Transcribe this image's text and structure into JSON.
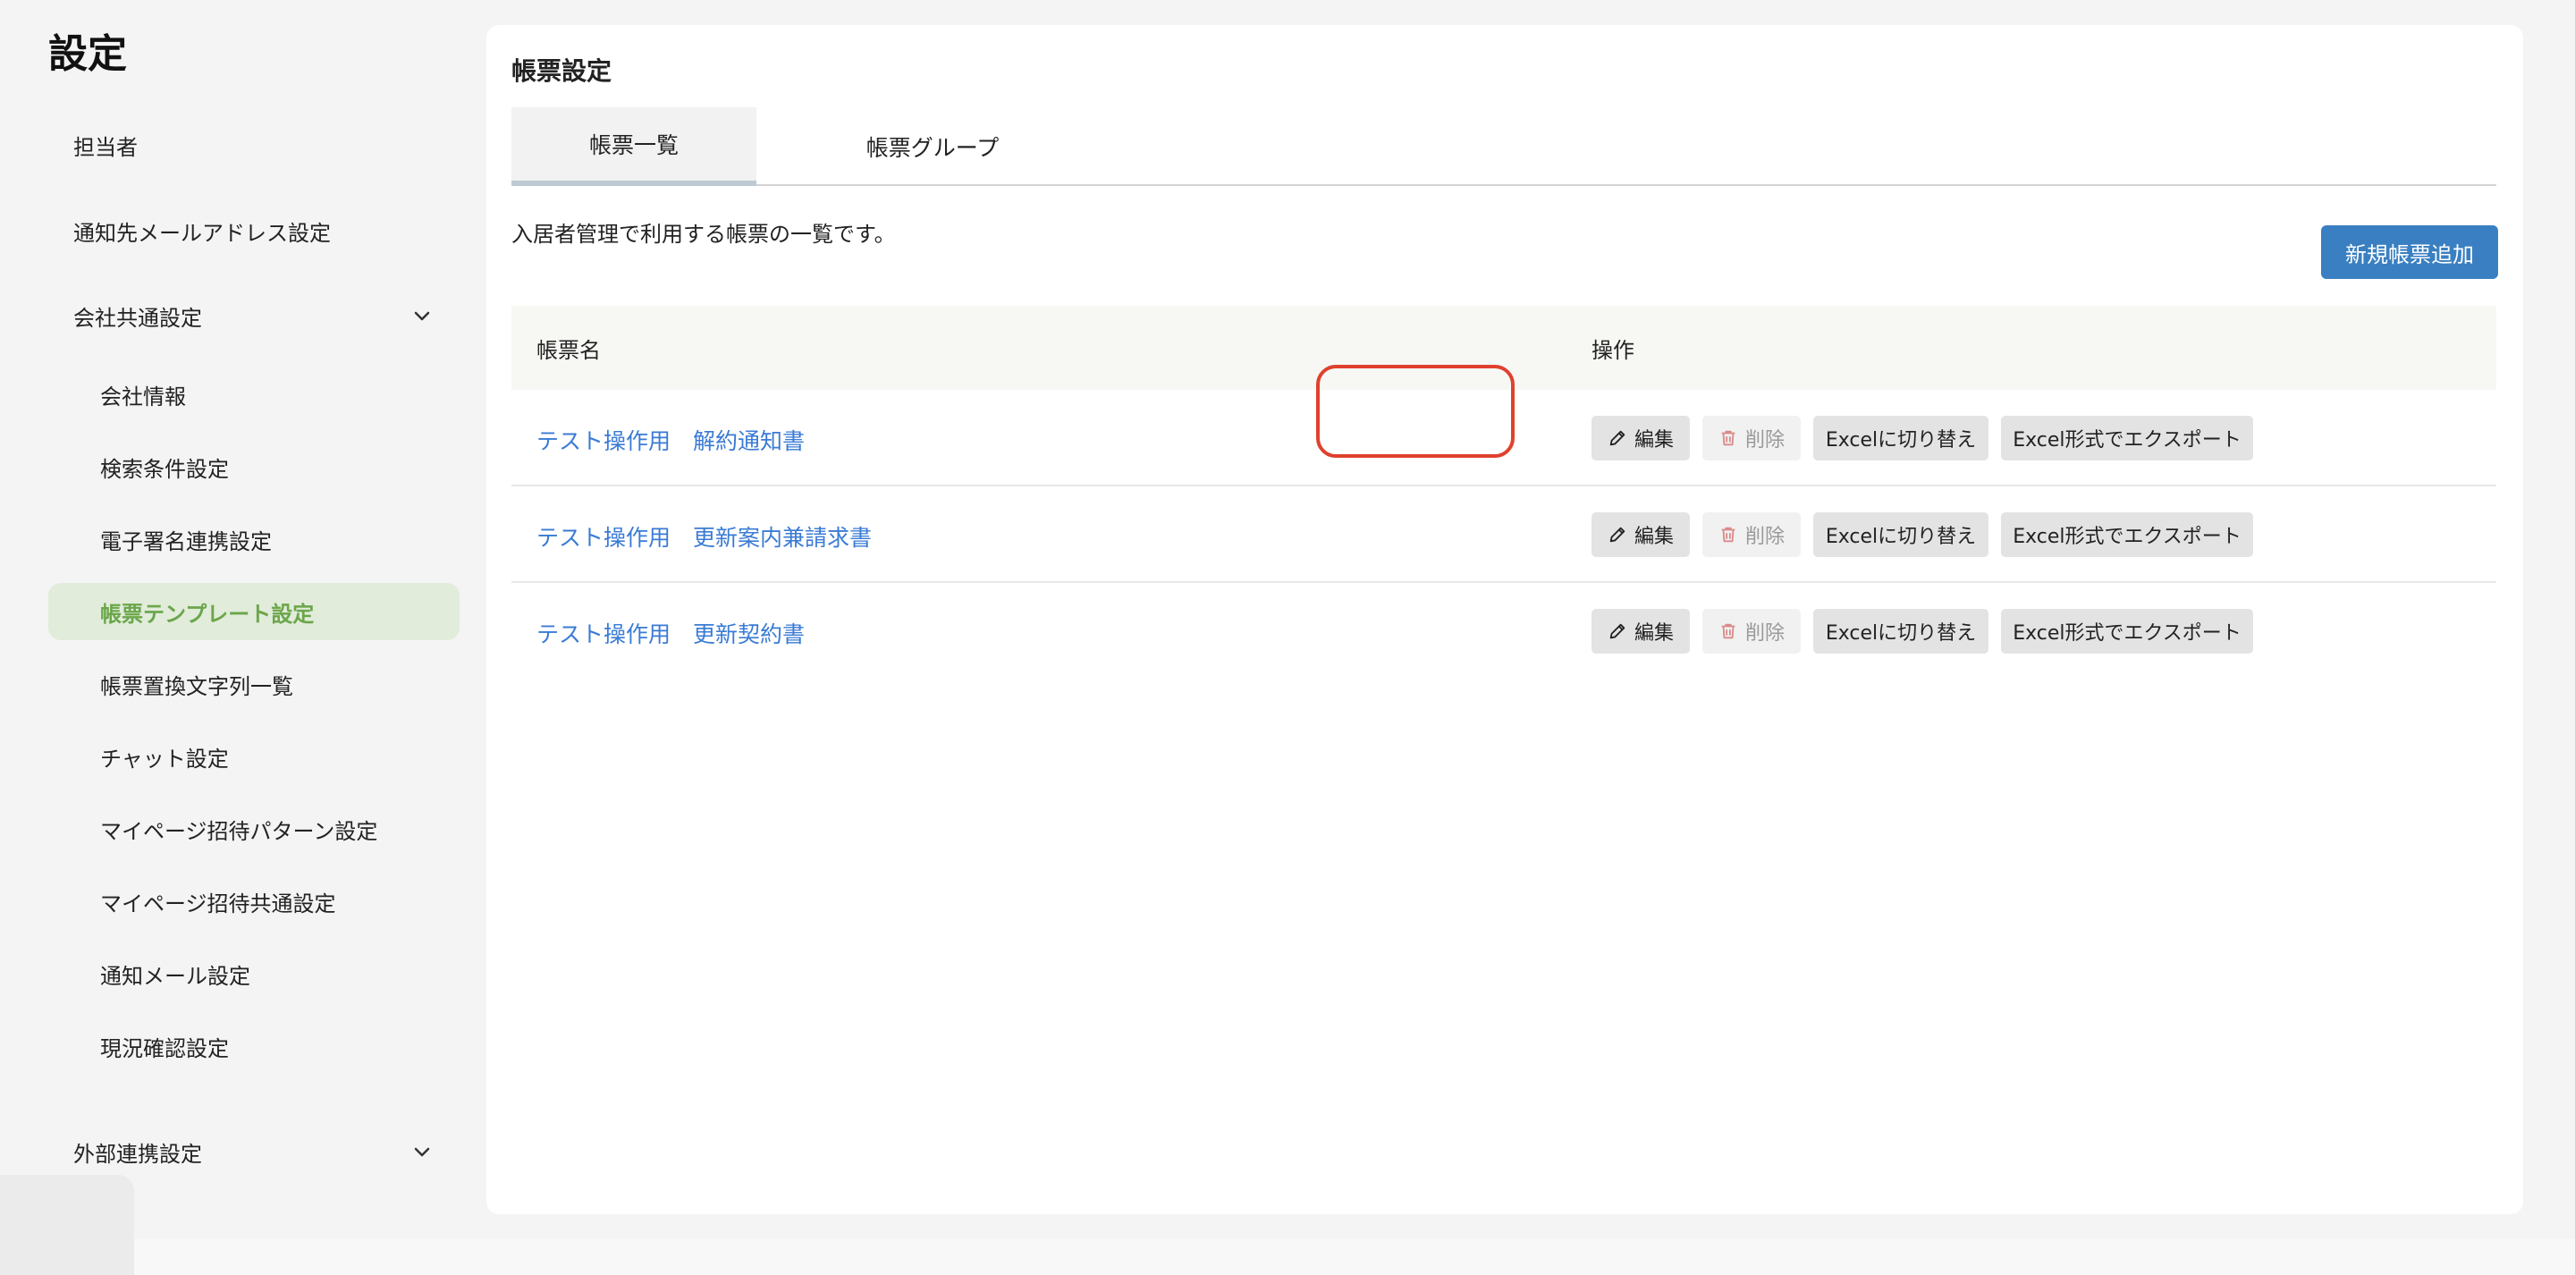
{
  "page_title": "設定",
  "sidebar": {
    "items": [
      {
        "label": "担当者"
      },
      {
        "label": "通知先メールアドレス設定"
      },
      {
        "label": "会社共通設定"
      },
      {
        "label": "会社情報"
      },
      {
        "label": "検索条件設定"
      },
      {
        "label": "電子署名連携設定"
      },
      {
        "label": "帳票テンプレート設定"
      },
      {
        "label": "帳票置換文字列一覧"
      },
      {
        "label": "チャット設定"
      },
      {
        "label": "マイページ招待パターン設定"
      },
      {
        "label": "マイページ招待共通設定"
      },
      {
        "label": "通知メール設定"
      },
      {
        "label": "現況確認設定"
      },
      {
        "label": "外部連携設定"
      }
    ]
  },
  "main": {
    "title": "帳票設定",
    "tabs": [
      {
        "label": "帳票一覧"
      },
      {
        "label": "帳票グループ"
      }
    ],
    "description": "入居者管理で利用する帳票の一覧です。",
    "add_button": "新規帳票追加",
    "table": {
      "headers": [
        "帳票名",
        "操作"
      ],
      "rows": [
        {
          "name": "テスト操作用　解約通知書"
        },
        {
          "name": "テスト操作用　更新案内兼請求書"
        },
        {
          "name": "テスト操作用　更新契約書"
        }
      ],
      "actions": {
        "edit": "編集",
        "delete": "削除",
        "switch_excel": "Excelに切り替え",
        "export_excel": "Excel形式でエクスポート"
      }
    }
  },
  "colors": {
    "accent": "#3a7fc1",
    "active_nav_bg": "#e1ecda",
    "active_nav_text": "#6ba64a",
    "link": "#3a7bd5",
    "highlight": "#e0412e"
  }
}
